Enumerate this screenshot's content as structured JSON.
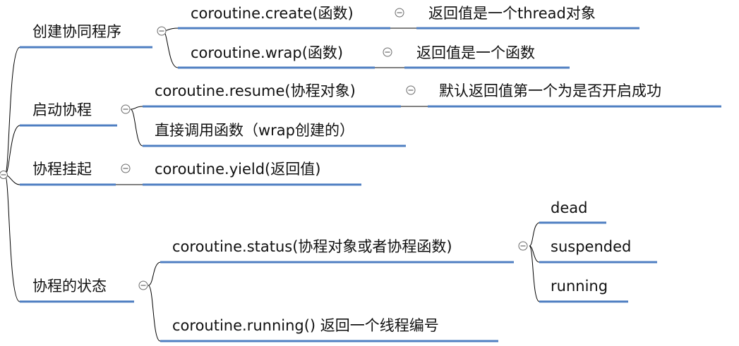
{
  "topics": [
    {
      "key": "create",
      "label": "创建协同程序",
      "children": [
        {
          "key": "create_fn",
          "label": "coroutine.create(函数)",
          "children": [
            {
              "key": "create_ret",
              "label": "返回值是一个thread对象"
            }
          ]
        },
        {
          "key": "wrap_fn",
          "label": "coroutine.wrap(函数)",
          "children": [
            {
              "key": "wrap_ret",
              "label": "返回值是一个函数"
            }
          ]
        }
      ]
    },
    {
      "key": "start",
      "label": "启动协程",
      "children": [
        {
          "key": "resume_fn",
          "label": "coroutine.resume(协程对象)",
          "children": [
            {
              "key": "resume_ret",
              "label": "默认返回值第一个为是否开启成功"
            }
          ]
        },
        {
          "key": "direct_call",
          "label": "直接调用函数（wrap创建的）"
        }
      ]
    },
    {
      "key": "suspend",
      "label": "协程挂起",
      "children": [
        {
          "key": "yield_fn",
          "label": "coroutine.yield(返回值)"
        }
      ]
    },
    {
      "key": "state",
      "label": "协程的状态",
      "children": [
        {
          "key": "status_fn",
          "label": "coroutine.status(协程对象或者协程函数)",
          "children": [
            {
              "key": "st_dead",
              "label": "dead"
            },
            {
              "key": "st_suspended",
              "label": "suspended"
            },
            {
              "key": "st_running",
              "label": "running"
            }
          ]
        },
        {
          "key": "running_fn",
          "label": "coroutine.running() 返回一个线程编号"
        }
      ]
    }
  ]
}
